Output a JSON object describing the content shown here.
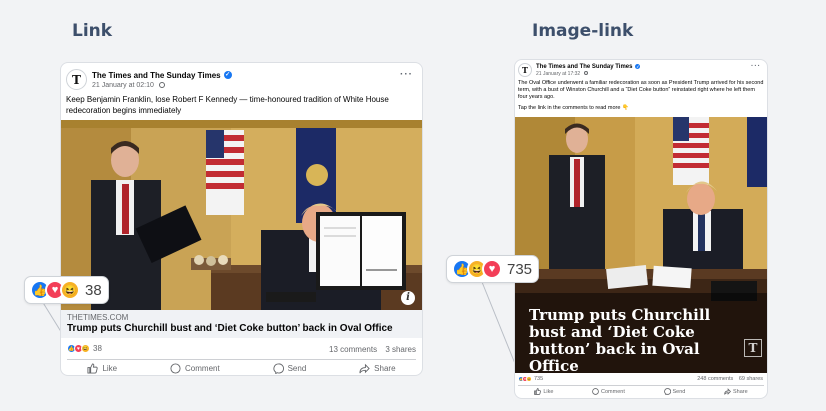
{
  "sections": {
    "left_title": "Link",
    "right_title": "Image-link"
  },
  "colors": {
    "facebook_blue": "#1877f2",
    "love_red": "#f33e58",
    "haha_yellow": "#f7b125",
    "heading": "#3d4f6b"
  },
  "link_post": {
    "page_name": "The Times and The Sunday Times",
    "timestamp": "21 January at 02:10",
    "caption": "Keep Benjamin Franklin, lose Robert F Kennedy — time-honoured tradition of White House redecoration begins immediately",
    "link_domain": "THETIMES.COM",
    "link_title": "Trump puts Churchill bust and ‘Diet Coke button’ back in Oval Office",
    "reaction_count": "38",
    "comments": "13 comments",
    "shares": "3 shares",
    "actions": {
      "like": "Like",
      "comment": "Comment",
      "send": "Send",
      "share": "Share"
    },
    "bubble_count": "38",
    "logo_letter": "T",
    "more_label": "···",
    "info_label": "i"
  },
  "image_post": {
    "page_name": "The Times and The Sunday Times",
    "timestamp": "21 January at 17:32",
    "caption": "The Oval Office underwent a familiar redecoration as soon as President Trump arrived for his second term, with a bust of Winston Churchill and a “Diet Coke button” reinstated right where he left them four years ago.",
    "caption_cta": "Tap the link in the comments to read more 👇",
    "overlay_title": "Trump puts Churchill bust and ‘Diet Coke button’ back in Oval Office",
    "reaction_count": "735",
    "comments": "248 comments",
    "shares": "69 shares",
    "actions": {
      "like": "Like",
      "comment": "Comment",
      "send": "Send",
      "share": "Share"
    },
    "bubble_count": "735",
    "logo_letter": "T",
    "more_label": "···",
    "watermark": "T"
  },
  "icons": {
    "verified": "verified-badge-icon",
    "like": "thumbs-up-icon",
    "love": "heart-icon",
    "haha": "laughing-face-icon"
  }
}
